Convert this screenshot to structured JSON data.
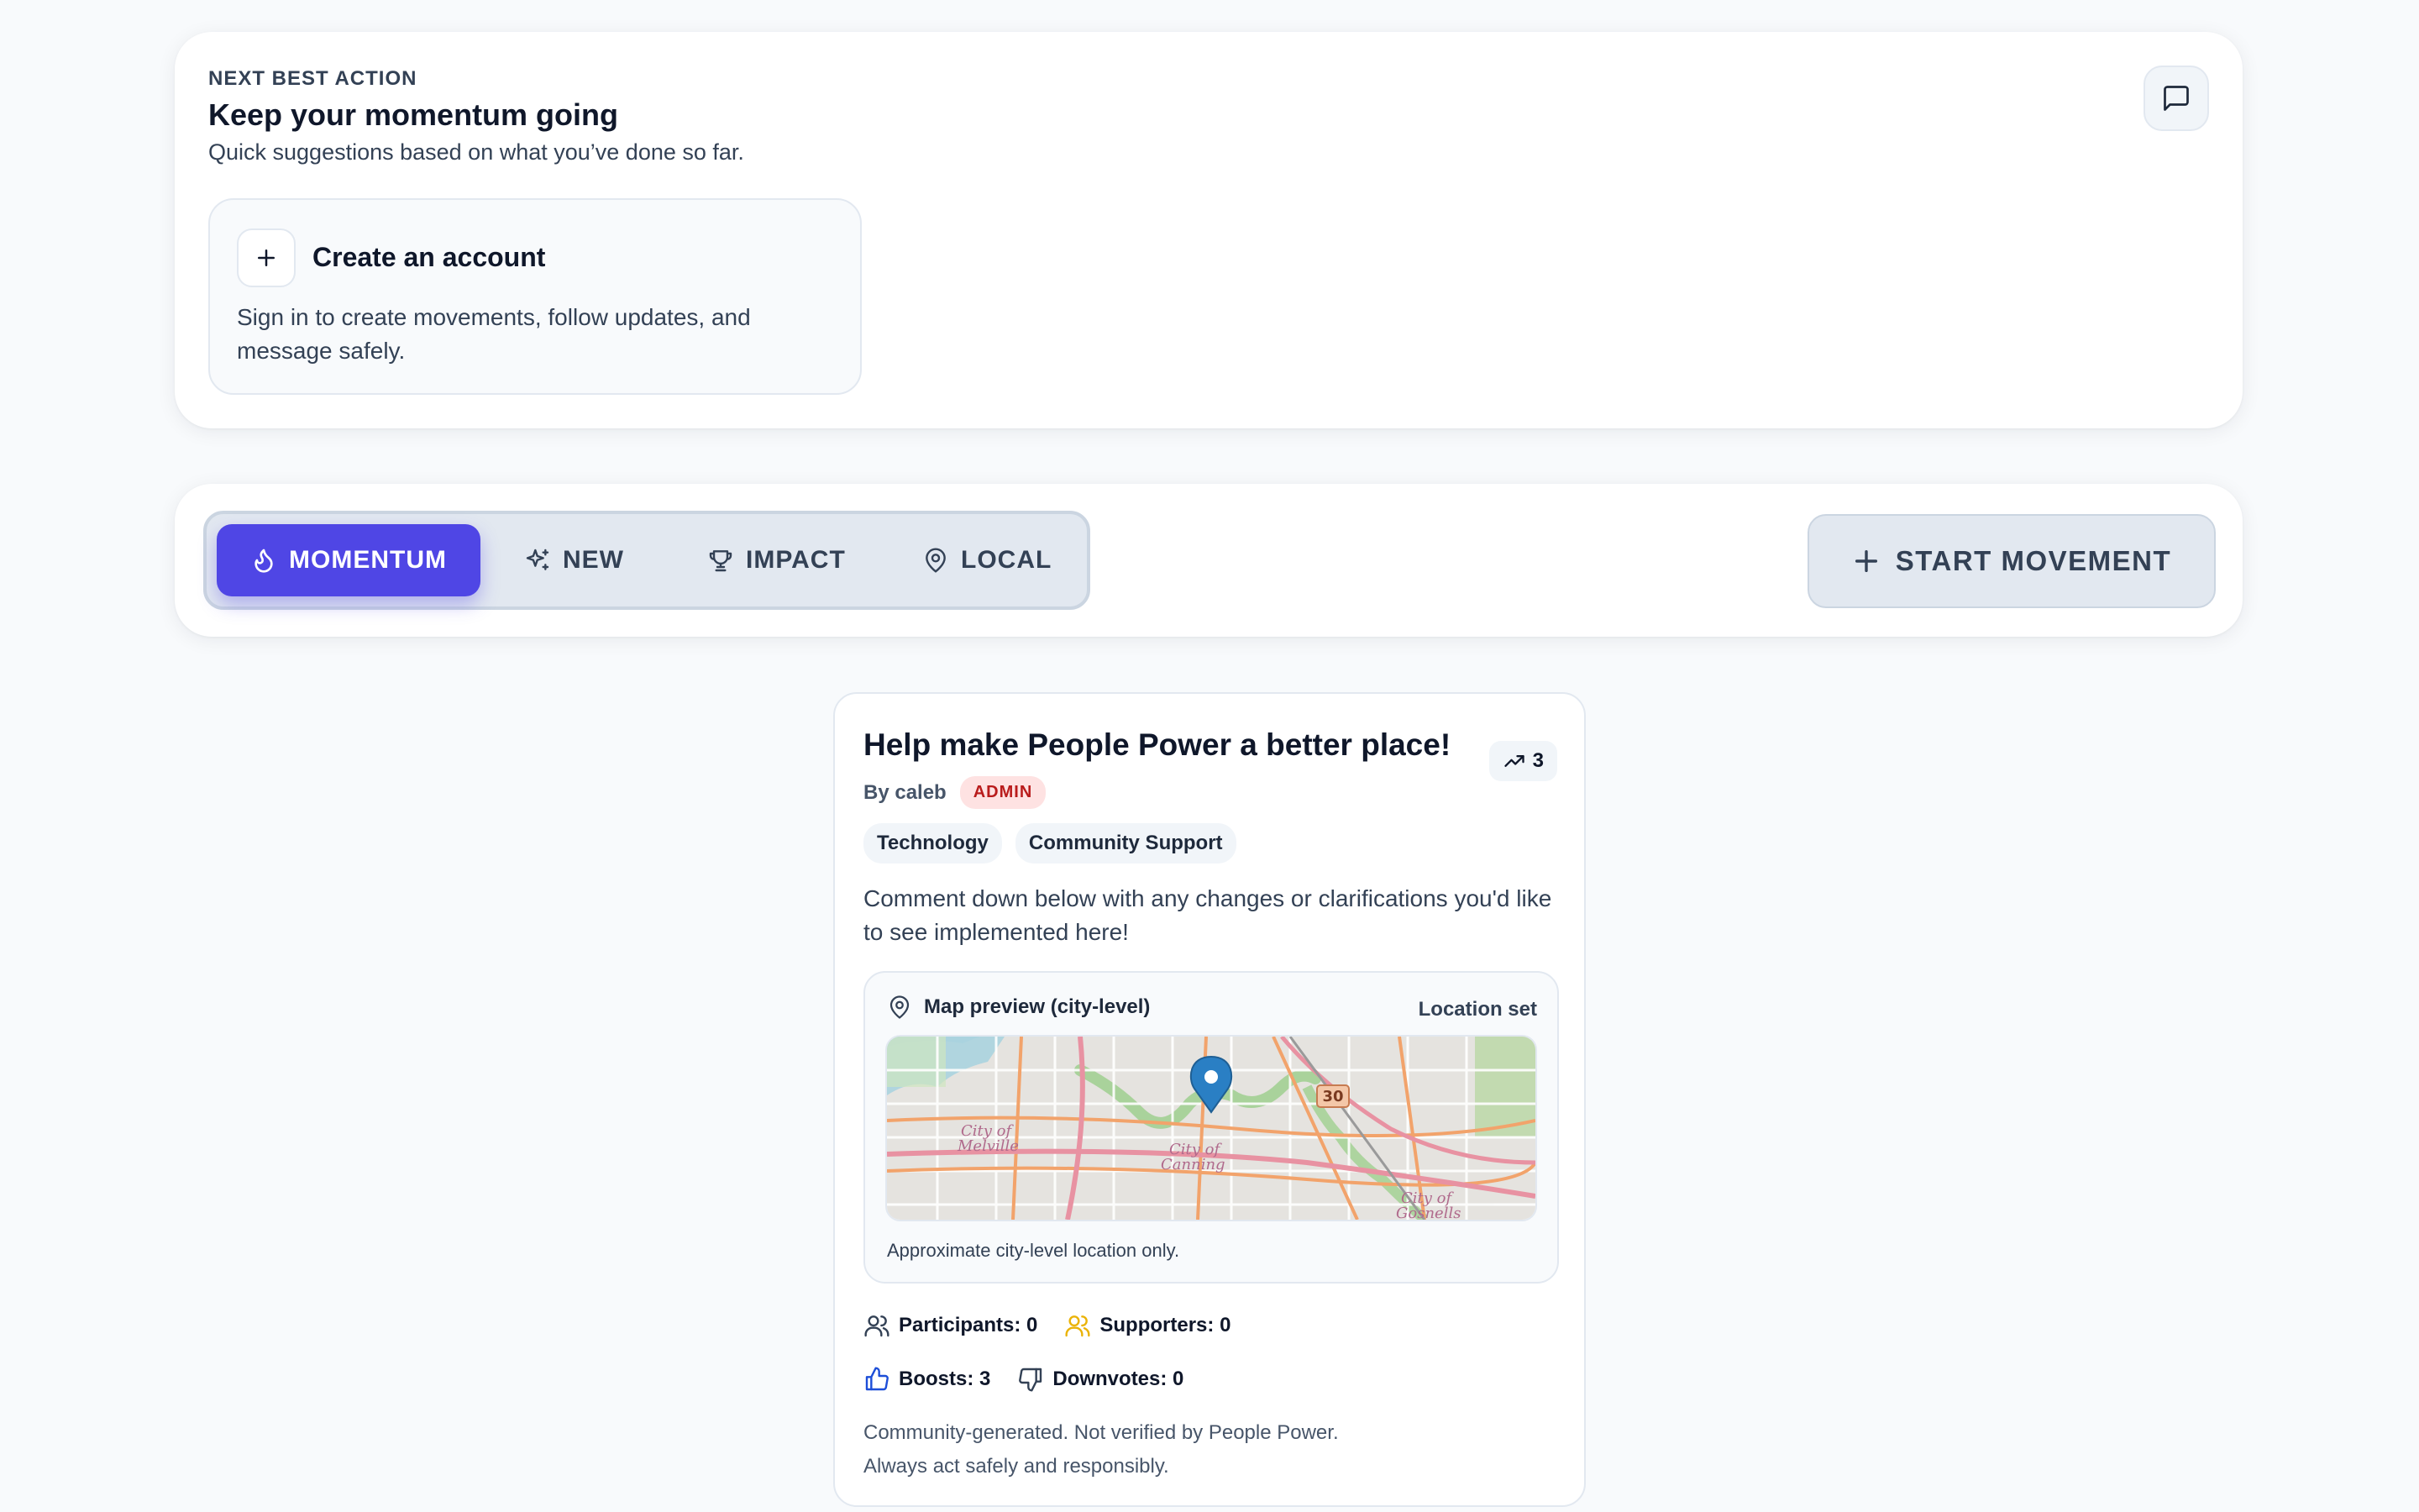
{
  "next_best_action": {
    "eyebrow": "NEXT BEST ACTION",
    "title": "Keep your momentum going",
    "subtitle": "Quick suggestions based on what you’ve done so far.",
    "suggestion": {
      "title": "Create an account",
      "description": "Sign in to create movements, follow updates, and message safely."
    }
  },
  "tabs": [
    {
      "label": "MOMENTUM",
      "icon": "flame-icon",
      "active": true
    },
    {
      "label": "NEW",
      "icon": "sparkles-icon",
      "active": false
    },
    {
      "label": "IMPACT",
      "icon": "trophy-icon",
      "active": false
    },
    {
      "label": "LOCAL",
      "icon": "map-pin-icon",
      "active": false
    }
  ],
  "start_movement_label": "START MOVEMENT",
  "movement": {
    "title": "Help make People Power a better place!",
    "trend_count": "3",
    "byline": "By caleb",
    "author_badge": "ADMIN",
    "tags": [
      "Technology",
      "Community Support"
    ],
    "description": "Comment down below with any changes or clarifications you'd like to see implemented here!",
    "map": {
      "heading": "Map preview (city-level)",
      "status": "Location set",
      "note": "Approximate city-level location only.",
      "labels": {
        "melville": "City of Melville",
        "canning": "City of Canning",
        "gosnells": "City of Gosnells",
        "route": "30"
      }
    },
    "stats": {
      "participants": "Participants: 0",
      "supporters": "Supporters: 0",
      "boosts": "Boosts: 3",
      "downvotes": "Downvotes: 0"
    },
    "disclaimer_line1": "Community-generated. Not verified by People Power.",
    "disclaimer_line2": "Always act safely and responsibly."
  },
  "colors": {
    "accent": "#4f46e5",
    "admin_bg": "#fee2e2",
    "admin_text": "#b91c1c",
    "supporter": "#eab308"
  }
}
